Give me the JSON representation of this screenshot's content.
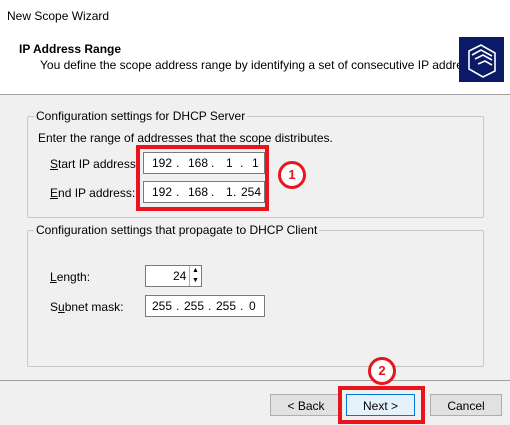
{
  "window": {
    "title": "New Scope Wizard"
  },
  "header": {
    "title": "IP Address Range",
    "subtitle": "You define the scope address range by identifying a set of consecutive IP addresses.",
    "icon": "folders-icon"
  },
  "server_group": {
    "legend": "Configuration settings for DHCP Server",
    "instruction": "Enter the range of addresses that the scope distributes.",
    "start_label": "Start IP address:",
    "start_ip": [
      "192",
      "168",
      "1",
      "1"
    ],
    "end_label": "End IP address:",
    "end_ip": [
      "192",
      "168",
      "1",
      "254"
    ]
  },
  "client_group": {
    "legend": "Configuration settings that propagate to DHCP Client",
    "length_label": "Length:",
    "length_value": "24",
    "mask_label": "Subnet mask:",
    "mask": [
      "255",
      "255",
      "255",
      "0"
    ]
  },
  "annotations": {
    "badge1": "1",
    "badge2": "2",
    "color": "#e8141e"
  },
  "buttons": {
    "back": "< Back",
    "next": "Next >",
    "cancel": "Cancel"
  }
}
